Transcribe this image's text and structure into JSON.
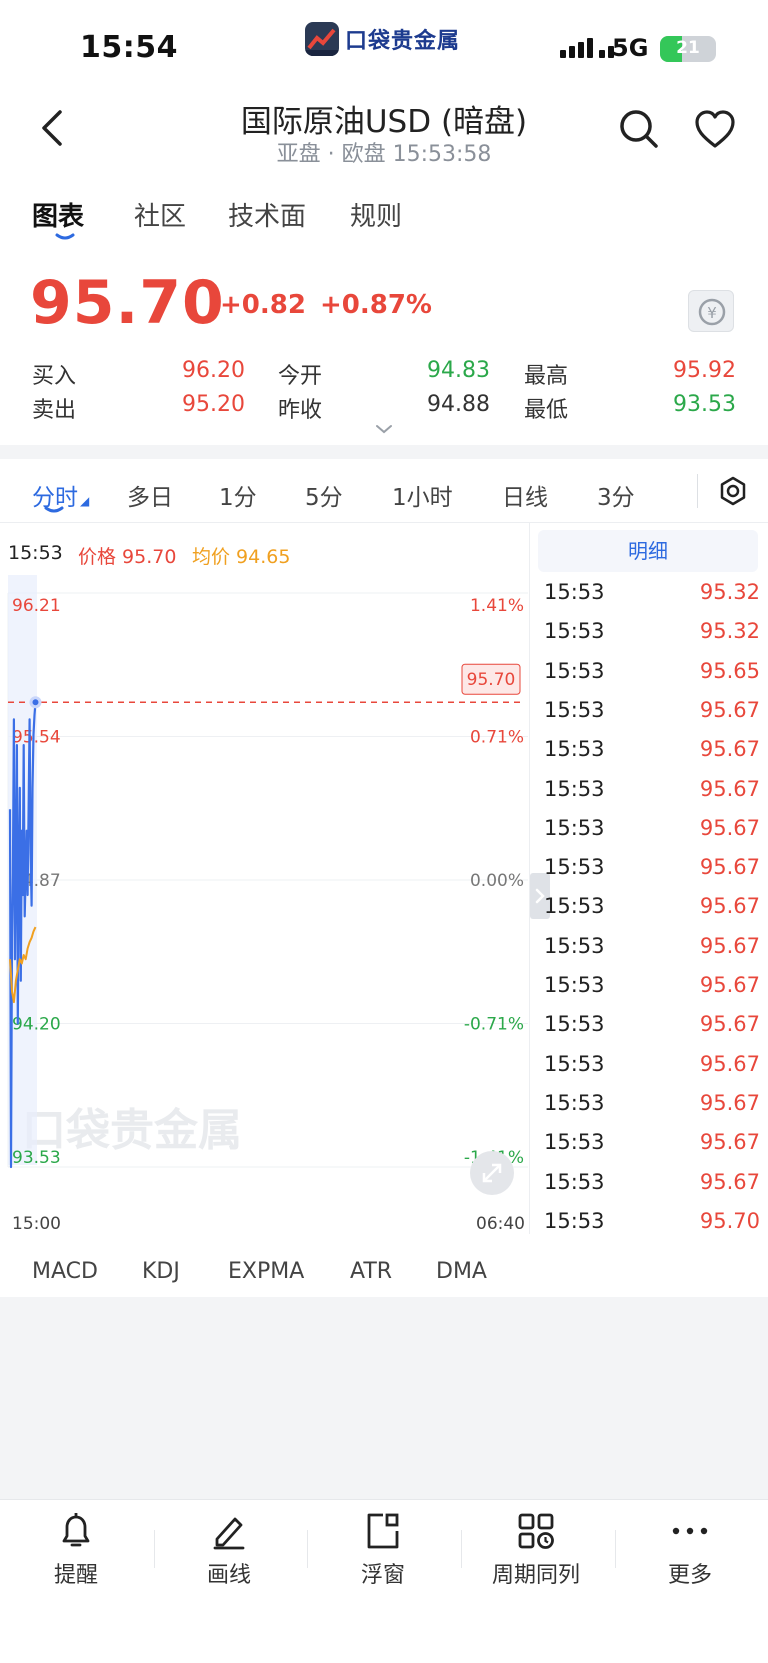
{
  "status": {
    "time": "15:54",
    "network": "5G",
    "battery": "21"
  },
  "app": {
    "logo_text": "口袋贵金属"
  },
  "header": {
    "title": "国际原油USD (暗盘)",
    "subtitle": "亚盘 · 欧盘 15:53:58"
  },
  "tabs": [
    "图表",
    "社区",
    "技术面",
    "规则"
  ],
  "quote": {
    "price": "95.70",
    "change": "+0.82",
    "change_pct": "+0.87%",
    "buy_label": "买入",
    "buy": "96.20",
    "sell_label": "卖出",
    "sell": "95.20",
    "open_label": "今开",
    "open": "94.83",
    "prev_close_label": "昨收",
    "prev_close": "94.88",
    "high_label": "最高",
    "high": "95.92",
    "low_label": "最低",
    "low": "93.53"
  },
  "periods": [
    "分时",
    "多日",
    "1分",
    "5分",
    "1小时",
    "日线",
    "3分"
  ],
  "chart_header": {
    "time": "15:53",
    "price_label": "价格 95.70",
    "avg_label": "均价 94.65"
  },
  "chart_data": {
    "type": "line",
    "y_left_ticks": [
      "96.21",
      "95.54",
      "94.87",
      "94.20",
      "93.53"
    ],
    "y_right_ticks": [
      "1.41%",
      "0.71%",
      "0.00%",
      "-0.71%",
      "-1.41%"
    ],
    "x_ticks": [
      "15:00",
      "06:40"
    ],
    "ylim": [
      93.53,
      96.21
    ],
    "current_price": "95.70",
    "watermark": "口袋贵金属",
    "series": [
      {
        "name": "价格",
        "color": "#3b6fe6",
        "x": [
          0,
          1,
          2,
          3,
          4,
          5,
          6,
          7,
          8,
          9,
          10,
          11,
          12,
          13,
          14,
          15,
          16,
          17,
          18,
          19,
          20,
          21,
          22,
          23,
          24,
          25,
          26
        ],
        "values": [
          95.2,
          93.53,
          94.6,
          94.9,
          95.62,
          94.5,
          94.95,
          95.5,
          94.2,
          94.9,
          95.3,
          94.4,
          95.1,
          94.8,
          95.5,
          94.7,
          94.9,
          95.1,
          94.8,
          95.2,
          95.62,
          95.0,
          94.75,
          95.3,
          95.55,
          95.64,
          95.7
        ]
      },
      {
        "name": "均价",
        "color": "#f0a020",
        "x": [
          0,
          2,
          4,
          6,
          8,
          10,
          12,
          14,
          16,
          18,
          20,
          22,
          24,
          26
        ],
        "values": [
          94.5,
          94.35,
          94.3,
          94.4,
          94.45,
          94.5,
          94.48,
          94.52,
          94.5,
          94.55,
          94.58,
          94.6,
          94.63,
          94.65
        ]
      }
    ]
  },
  "detail": {
    "header": "明细",
    "rows": [
      {
        "time": "15:53",
        "price": "95.32"
      },
      {
        "time": "15:53",
        "price": "95.32"
      },
      {
        "time": "15:53",
        "price": "95.65"
      },
      {
        "time": "15:53",
        "price": "95.67"
      },
      {
        "time": "15:53",
        "price": "95.67"
      },
      {
        "time": "15:53",
        "price": "95.67"
      },
      {
        "time": "15:53",
        "price": "95.67"
      },
      {
        "time": "15:53",
        "price": "95.67"
      },
      {
        "time": "15:53",
        "price": "95.67"
      },
      {
        "time": "15:53",
        "price": "95.67"
      },
      {
        "time": "15:53",
        "price": "95.67"
      },
      {
        "time": "15:53",
        "price": "95.67"
      },
      {
        "time": "15:53",
        "price": "95.67"
      },
      {
        "time": "15:53",
        "price": "95.67"
      },
      {
        "time": "15:53",
        "price": "95.67"
      },
      {
        "time": "15:53",
        "price": "95.67"
      },
      {
        "time": "15:53",
        "price": "95.70"
      }
    ]
  },
  "indicators": [
    "MACD",
    "KDJ",
    "EXPMA",
    "ATR",
    "DMA"
  ],
  "bottom_bar": [
    "提醒",
    "画线",
    "浮窗",
    "周期同列",
    "更多"
  ],
  "colors": {
    "up": "#e8473b",
    "down": "#2ba84a",
    "accent": "#2d6ae0",
    "avg": "#f0a020"
  }
}
